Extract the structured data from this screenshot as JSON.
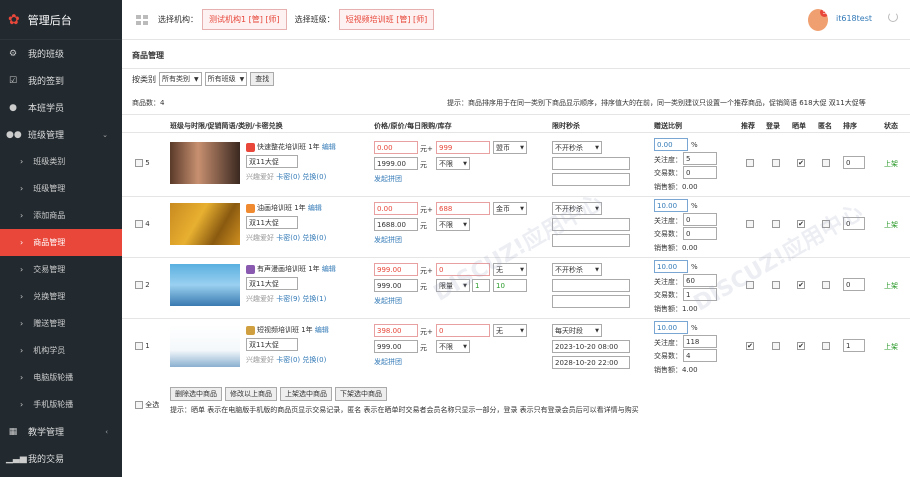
{
  "app": {
    "title": "管理后台"
  },
  "sidebar": {
    "items": [
      {
        "label": "我的班级",
        "icon": "gear-icon"
      },
      {
        "label": "我的签到",
        "icon": "check-square-icon"
      },
      {
        "label": "本班学员",
        "icon": "user-icon"
      },
      {
        "label": "班级管理",
        "icon": "users-icon"
      }
    ],
    "subitems": [
      "班级类别",
      "班级管理",
      "添加商品",
      "商品管理",
      "交易管理",
      "兑换管理",
      "赠送管理",
      "机构学员",
      "电脑版轮播",
      "手机版轮播"
    ],
    "bottom": [
      {
        "label": "教学管理",
        "icon": "grid-icon"
      },
      {
        "label": "我的交易",
        "icon": "bars-icon"
      }
    ]
  },
  "topbar": {
    "org_label": "选择机构：",
    "org_value": "测试机构1 [管] [师]",
    "class_label": "选择班级：",
    "class_value": "短视频培训班 [管] [师]",
    "user": "it618test",
    "badge": "5"
  },
  "main": {
    "title": "商品管理",
    "filter": {
      "label": "按类别",
      "sel1": "所有类别",
      "sel2": "所有班级",
      "search": "查找"
    },
    "count": "商品数：4",
    "tip": "提示：商品排序用于在同一类别下商品显示顺序，排序值大的在前，同一类别建议只设置一个推荐商品，促销简语 618大促 双11大促等",
    "headers": [
      "班级与时限/促销简语/类别/卡密兑换",
      "价格/原价/每日限购/库存",
      "限时秒杀",
      "赠送比例",
      "推荐",
      "登录",
      "晒单",
      "匿名",
      "排序",
      "状态"
    ],
    "rows": [
      {
        "id": "5",
        "name": "快速整花培训班 1年",
        "edit": "编辑",
        "promo": "双11大促",
        "cat": "兴趣爱好",
        "card": "卡密(0)",
        "exchange": "兑换(0)",
        "price": "0.00",
        "yuan": "元+",
        "points": "999",
        "unit": "盟币",
        "orig": "1999.00",
        "limit": "不限",
        "flash": "不开秒杀",
        "pt": "发起拼团",
        "ratio": "0.00",
        "focus_label": "关注度：",
        "focus": "5",
        "deals_label": "交易数：",
        "deals": "0",
        "sales_label": "销售额：",
        "sales": "0.00",
        "sort": "0",
        "status": "上架",
        "recommend": false,
        "login": false,
        "show": true,
        "anon": false,
        "limit_n": "",
        "stock": "",
        "t1": "",
        "t2": ""
      },
      {
        "id": "4",
        "name": "油画培训班 1年",
        "edit": "编辑",
        "promo": "双11大促",
        "cat": "兴趣爱好",
        "card": "卡密(0)",
        "exchange": "兑换(0)",
        "price": "0.00",
        "yuan": "元+",
        "points": "688",
        "unit": "金币",
        "orig": "1688.00",
        "limit": "不限",
        "flash": "不开秒杀",
        "pt": "发起拼团",
        "ratio": "10.00",
        "focus_label": "关注度：",
        "focus": "0",
        "deals_label": "交易数：",
        "deals": "0",
        "sales_label": "销售额：",
        "sales": "0.00",
        "sort": "0",
        "status": "上架",
        "recommend": false,
        "login": false,
        "show": true,
        "anon": false,
        "limit_n": "",
        "stock": "",
        "t1": "",
        "t2": ""
      },
      {
        "id": "2",
        "name": "有声漫画培训班 1年",
        "edit": "编辑",
        "promo": "双11大促",
        "cat": "兴趣爱好",
        "card": "卡密(9)",
        "exchange": "兑换(1)",
        "price": "999.00",
        "yuan": "元+",
        "points": "0",
        "unit": "无",
        "orig": "999.00",
        "limit": "限量",
        "flash": "不开秒杀",
        "pt": "发起拼团",
        "ratio": "10.00",
        "focus_label": "关注度：",
        "focus": "60",
        "deals_label": "交易数：",
        "deals": "1",
        "sales_label": "销售额：",
        "sales": "1.00",
        "sort": "0",
        "status": "上架",
        "recommend": false,
        "login": false,
        "show": true,
        "anon": false,
        "limit_n": "1",
        "stock": "10",
        "t1": "",
        "t2": ""
      },
      {
        "id": "1",
        "name": "短视频培训班 1年",
        "edit": "编辑",
        "promo": "双11大促",
        "cat": "兴趣爱好",
        "card": "卡密(0)",
        "exchange": "兑换(0)",
        "price": "398.00",
        "yuan": "元+",
        "points": "0",
        "unit": "无",
        "orig": "999.00",
        "limit": "不限",
        "flash": "每天时段",
        "pt": "发起拼团",
        "ratio": "10.00",
        "focus_label": "关注度：",
        "focus": "118",
        "deals_label": "交易数：",
        "deals": "4",
        "sales_label": "销售额：",
        "sales": "4.00",
        "sort": "1",
        "status": "上架",
        "recommend": true,
        "login": false,
        "show": true,
        "anon": false,
        "limit_n": "",
        "stock": "",
        "t1": "2023-10-20 08:00",
        "t2": "2028-10-20 22:00"
      }
    ],
    "select_all": "全选",
    "buttons": [
      "删除选中商品",
      "修改以上商品",
      "上架选中商品",
      "下架选中商品"
    ],
    "bottom_tip": "提示：晒单 表示在电脑版手机版的商品页显示交易记录，匿名 表示在晒单时交易者会员名称只显示一部分，登录 表示只有登录会员后可以看详情与购买",
    "percent": "%"
  },
  "colors": {
    "accent": "#e8473a",
    "sidebar": "#222a30",
    "link": "#337ab7",
    "status": "#2a9a2a"
  }
}
